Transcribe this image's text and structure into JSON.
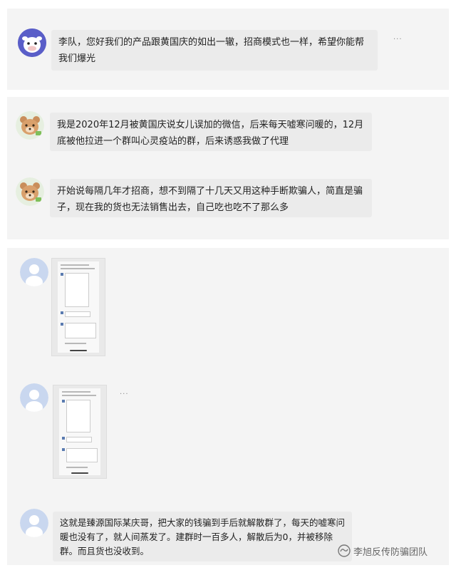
{
  "messages": [
    {
      "text": "李队，您好我们的产品跟黄国庆的如出一辙，招商模式也一样，希望你能帮我们爆光",
      "avatar": "cow-avatar-icon"
    },
    {
      "text": "我是2020年12月被黄国庆说女儿误加的微信，后来每天嘘寒问暖的，12月底被他拉进一个群叫心灵疫站的群，后来诱惑我做了代理",
      "avatar": "bear-avatar-icon"
    },
    {
      "text": "开始说每隔几年才招商，想不到隔了十几天又用这种手断欺骗人，简直是骗子，现在我的货也无法销售出去，自己吃也吃不了那么多",
      "avatar": "bear-avatar-icon"
    },
    {
      "text": "这就是臻源国际某庆哥，把大家的钱骗到手后就解散群了，每天的嘘寒问暖也没有了，就人间蒸发了。建群时一百多人，解散后为0，并被移除群。而且货也没收到。",
      "avatar": "default-user-avatar-icon"
    }
  ],
  "more_label": "···",
  "watermark": {
    "label": "李旭反传防骗团队",
    "icon": "wechat-channel-icon"
  },
  "colors": {
    "card_bg": "#f4f4f4",
    "bubble_bg": "#ebebeb",
    "default_avatar": "#c9d7ef"
  }
}
